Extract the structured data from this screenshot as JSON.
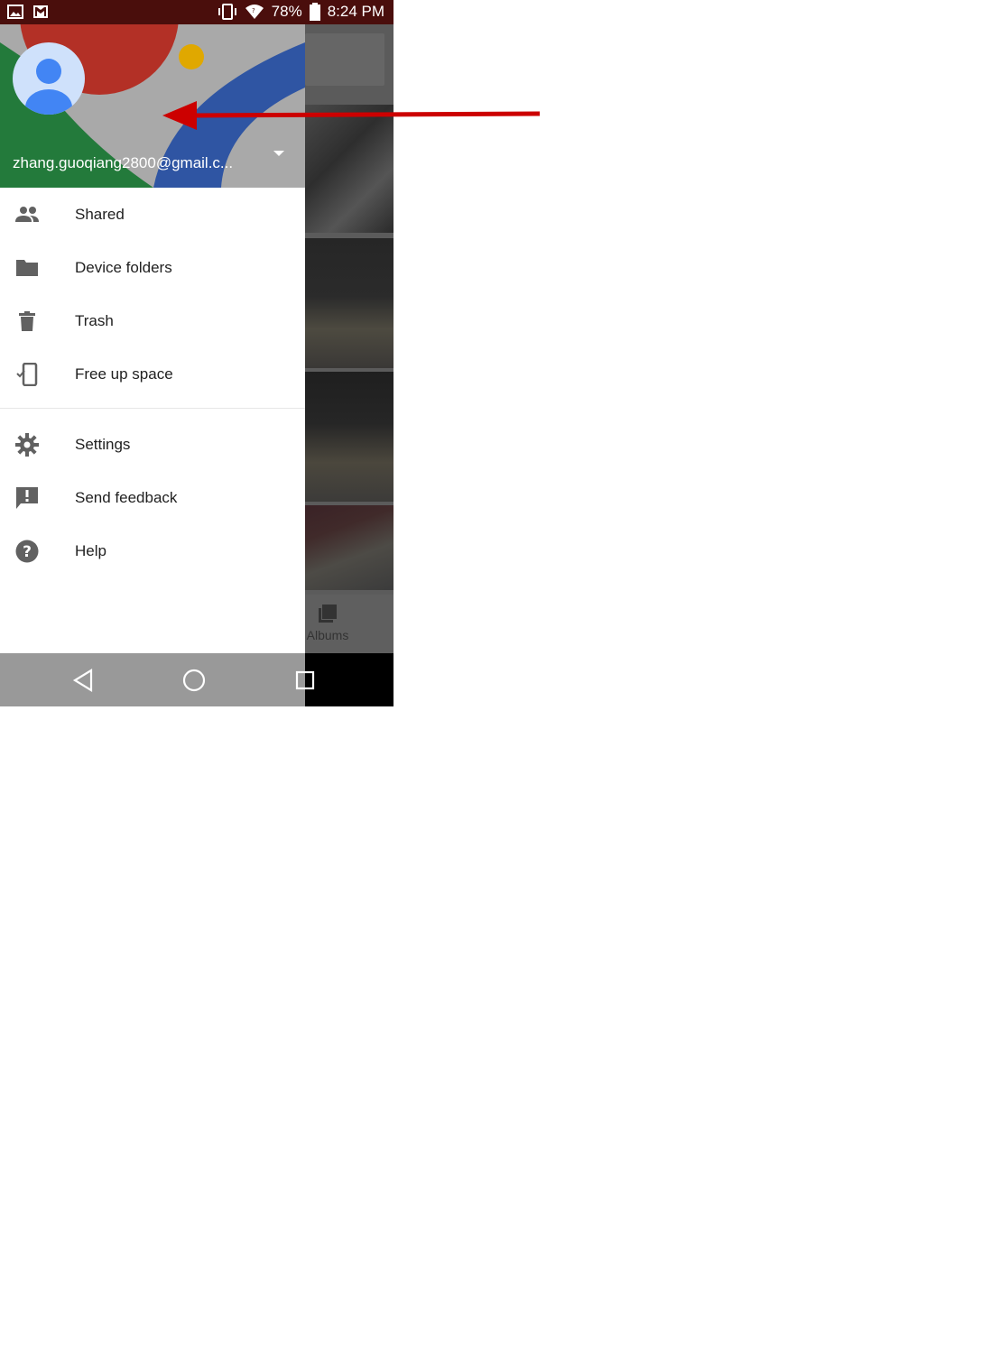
{
  "status_bar": {
    "battery": "78%",
    "time": "8:24 PM",
    "icons": [
      "image-icon",
      "gmail-icon",
      "vibrate-icon",
      "wifi-icon",
      "battery-icon"
    ]
  },
  "drawer": {
    "account_email": "zhang.guoqiang2800@gmail.c...",
    "menu": [
      {
        "label": "Shared",
        "icon": "people-icon"
      },
      {
        "label": "Device folders",
        "icon": "folder-icon"
      },
      {
        "label": "Trash",
        "icon": "trash-icon"
      },
      {
        "label": "Free up space",
        "icon": "phone-check-icon"
      }
    ],
    "menu2": [
      {
        "label": "Settings",
        "icon": "gear-icon"
      },
      {
        "label": "Send feedback",
        "icon": "feedback-icon"
      },
      {
        "label": "Help",
        "icon": "help-icon"
      }
    ]
  },
  "background_app": {
    "bottom_tab": "Albums"
  },
  "colors": {
    "annotation_arrow": "#cc0000",
    "header_red": "#b33026",
    "header_blue": "#2f55a3",
    "header_green": "#237a3b",
    "header_yellow": "#e0a800"
  }
}
